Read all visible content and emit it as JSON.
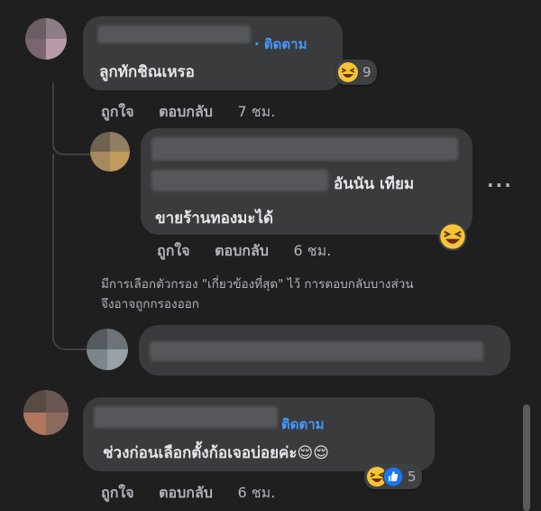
{
  "comments": [
    {
      "follow_label": "· ติดตาม",
      "text": "ลูกทักชิณเหรอ",
      "reaction_count": "9",
      "actions": {
        "like": "ถูกใจ",
        "reply": "ตอบกลับ",
        "time": "7 ชม."
      }
    },
    {
      "text_line1": "อันนัน เทียม",
      "text_line2": "ขายร้านทองมะได้",
      "more_label": "...",
      "actions": {
        "like": "ถูกใจ",
        "reply": "ตอบกลับ",
        "time": "6 ชม."
      }
    },
    {
      "follow_label": "ติดตาม",
      "text": "ช่วงก่อนเลือกตั้งก้อเจอบ่อยค่ะ😌😌",
      "reaction_count": "5",
      "actions": {
        "like": "ถูกใจ",
        "reply": "ตอบกลับ",
        "time": "6 ชม."
      }
    }
  ],
  "filter_notice": {
    "line1": "มีการเลือกตัวกรอง \"เกี่ยวข้องที่สุด\" ไว้ การตอบกลับบางส่วน",
    "line2": "จึงอาจถูกกรองออก"
  },
  "colors": {
    "background": "#1f1f20",
    "bubble": "#3a3b3c",
    "follow": "#4599ff",
    "muted": "#b0b3b8"
  },
  "icons": {
    "laugh": "laughing-emoji-icon",
    "relieved": "relieved-emoji-icon",
    "like": "thumbs-up-icon",
    "more": "more-options-icon"
  }
}
